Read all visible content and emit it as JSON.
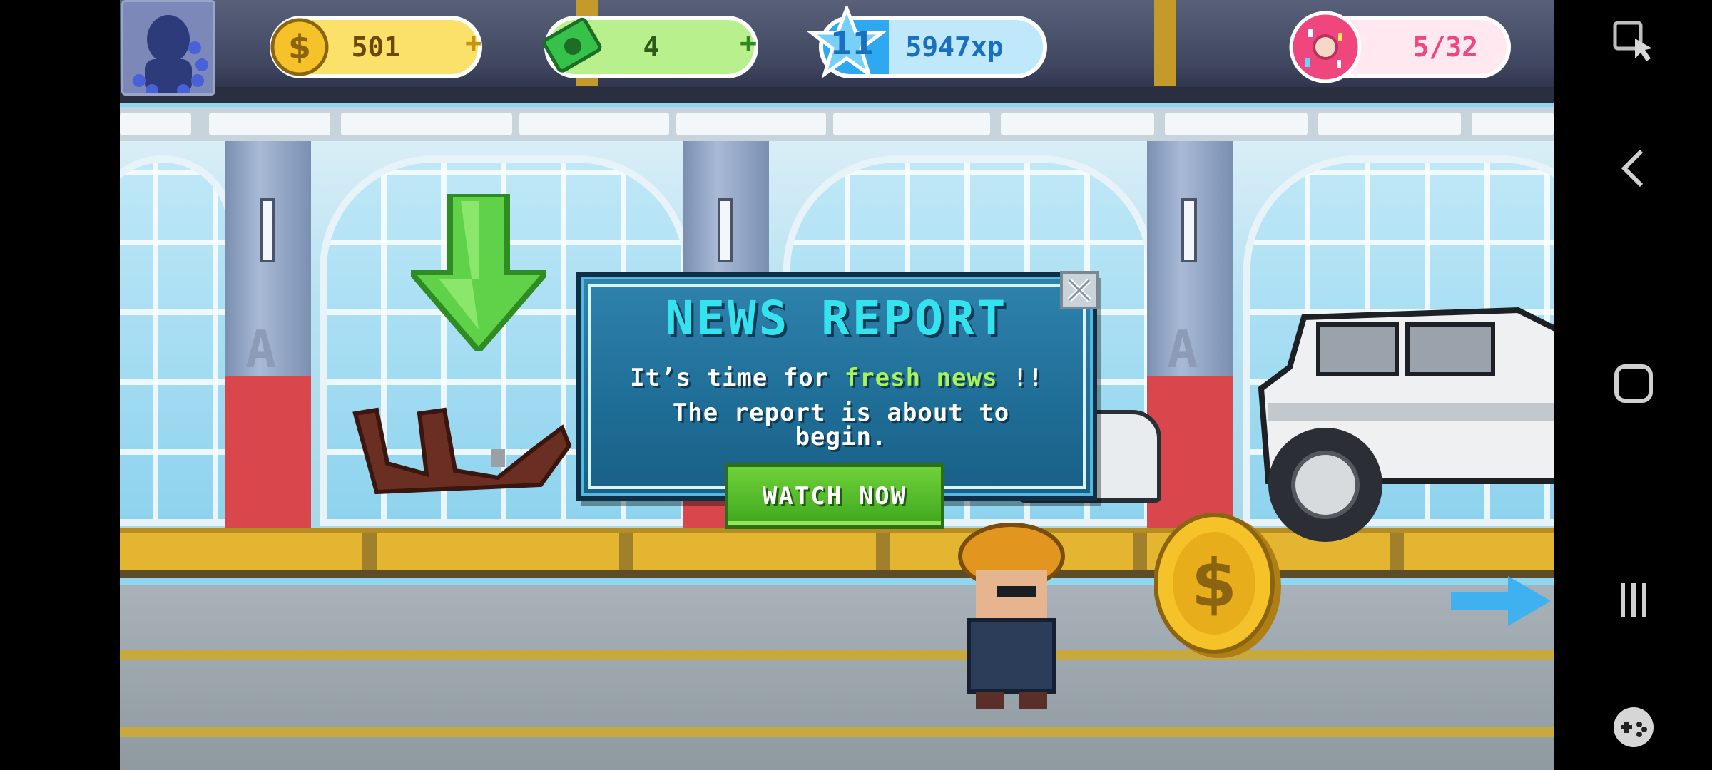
{
  "hud": {
    "coins": "501",
    "cash": "4",
    "level": "11",
    "xp": "5947xp",
    "xp_progress": 0.3,
    "donuts": "5/32",
    "donut_progress": 0.16
  },
  "popup": {
    "title": "NEWS REPORT",
    "line1_prefix": "It’s time for",
    "line1_highlight": "fresh news",
    "line1_suffix": "!!",
    "line2": "The report is about to begin.",
    "button": "WATCH NOW"
  },
  "colors": {
    "coin": "#f5c229",
    "cash": "#36c24a",
    "xp": "#2ea8f0",
    "donut": "#f0467e",
    "title": "#35e3ee",
    "highlight": "#a8f25a",
    "button": "#4fb927"
  },
  "icons": {
    "coin": "dollar-coin-icon",
    "cash": "cash-bill-icon",
    "level": "level-star-icon",
    "donut": "donut-icon",
    "close": "close-icon",
    "screenshot": "screenshot-touch-icon",
    "back": "chevron-left-icon",
    "home": "home-square-icon",
    "recents": "recents-icon",
    "gamepad": "gamepad-icon"
  }
}
